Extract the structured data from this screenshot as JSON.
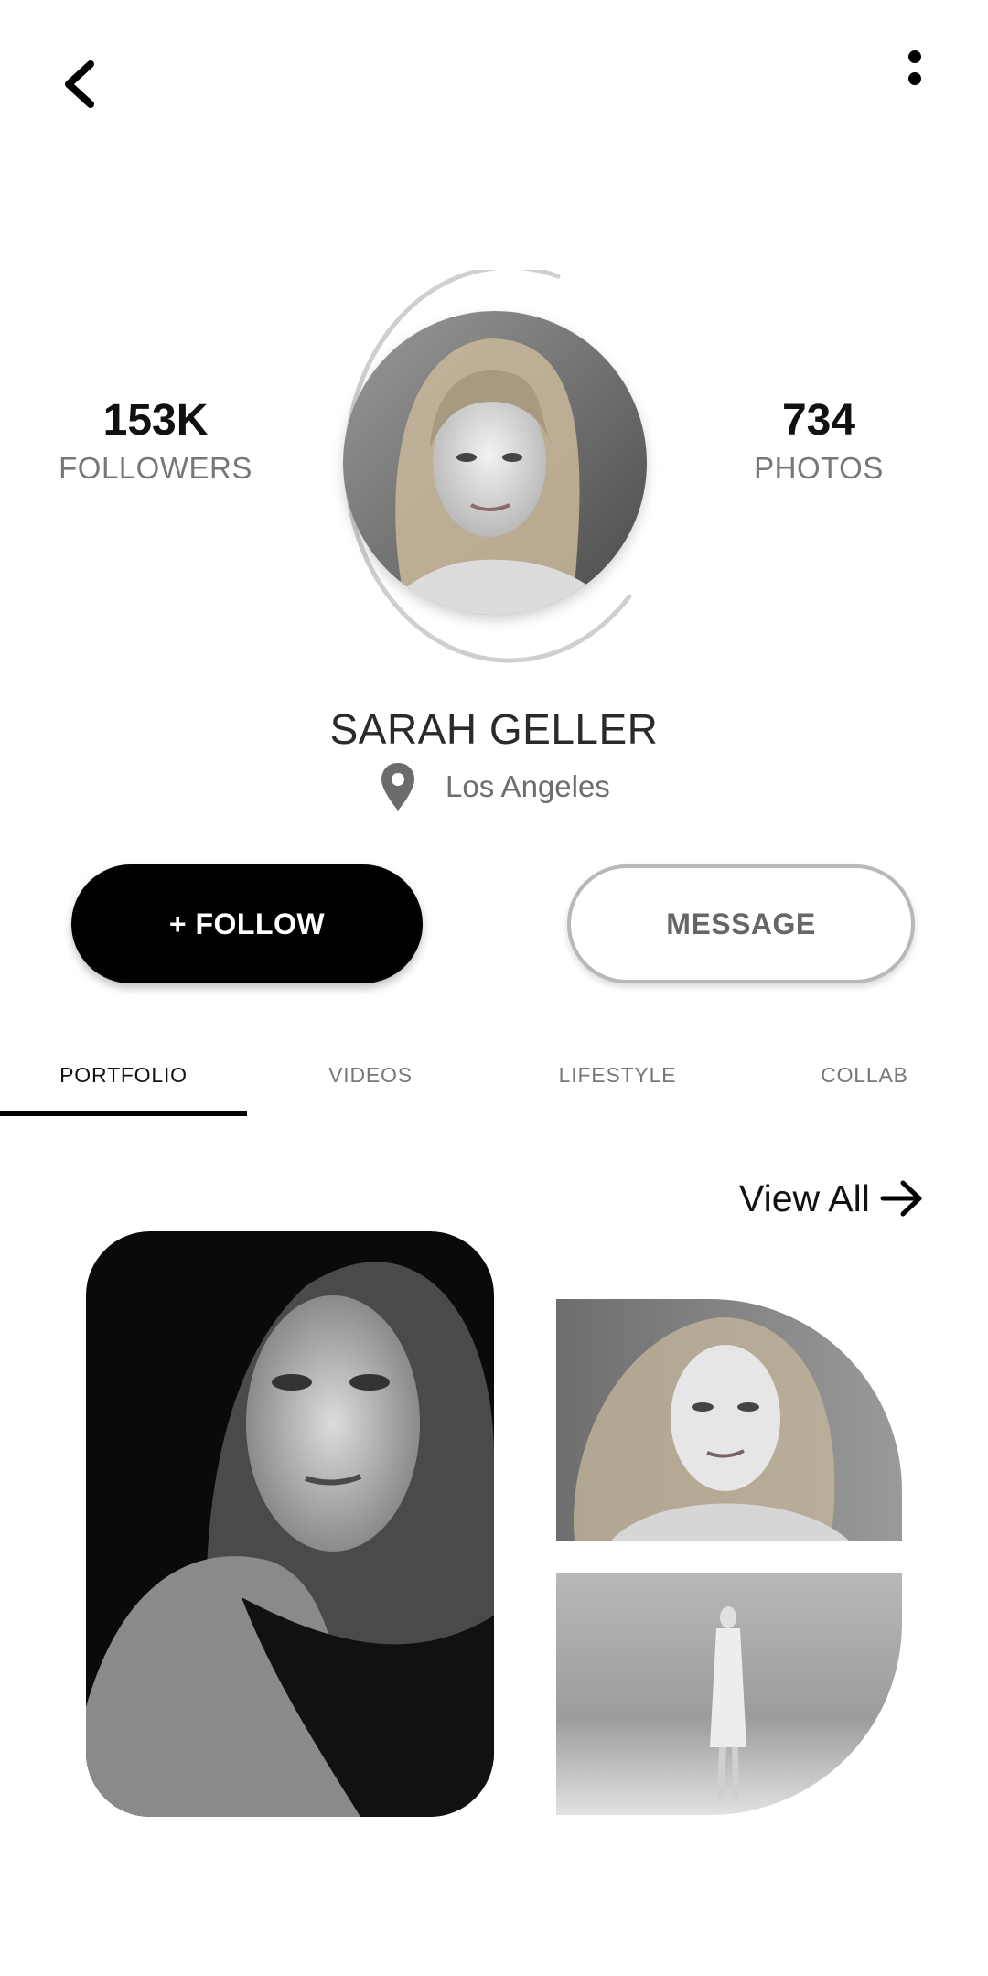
{
  "header": {
    "back_icon": "chevron-left-icon",
    "more_icon": "vertical-dots-icon"
  },
  "profile": {
    "name": "SARAH GELLER",
    "location": "Los Angeles",
    "location_icon": "map-pin-icon",
    "avatar": "profile-photo"
  },
  "stats": {
    "followers_value": "153K",
    "followers_label": "FOLLOWERS",
    "photos_value": "734",
    "photos_label": "PHOTOS"
  },
  "actions": {
    "follow_label": "+ FOLLOW",
    "message_label": "MESSAGE"
  },
  "tabs": [
    {
      "label": "PORTFOLIO",
      "active": true
    },
    {
      "label": "VIDEOS",
      "active": false
    },
    {
      "label": "LIFESTYLE",
      "active": false
    },
    {
      "label": "COLLAB",
      "active": false
    }
  ],
  "gallery": {
    "view_all_label": "View All",
    "view_all_icon": "arrow-right-icon",
    "photos": [
      "portrait-closeup",
      "portrait-windblown",
      "full-length-standing"
    ]
  },
  "colors": {
    "primary": "#000000",
    "secondary_text": "#777777",
    "ring": "#cccccc"
  }
}
